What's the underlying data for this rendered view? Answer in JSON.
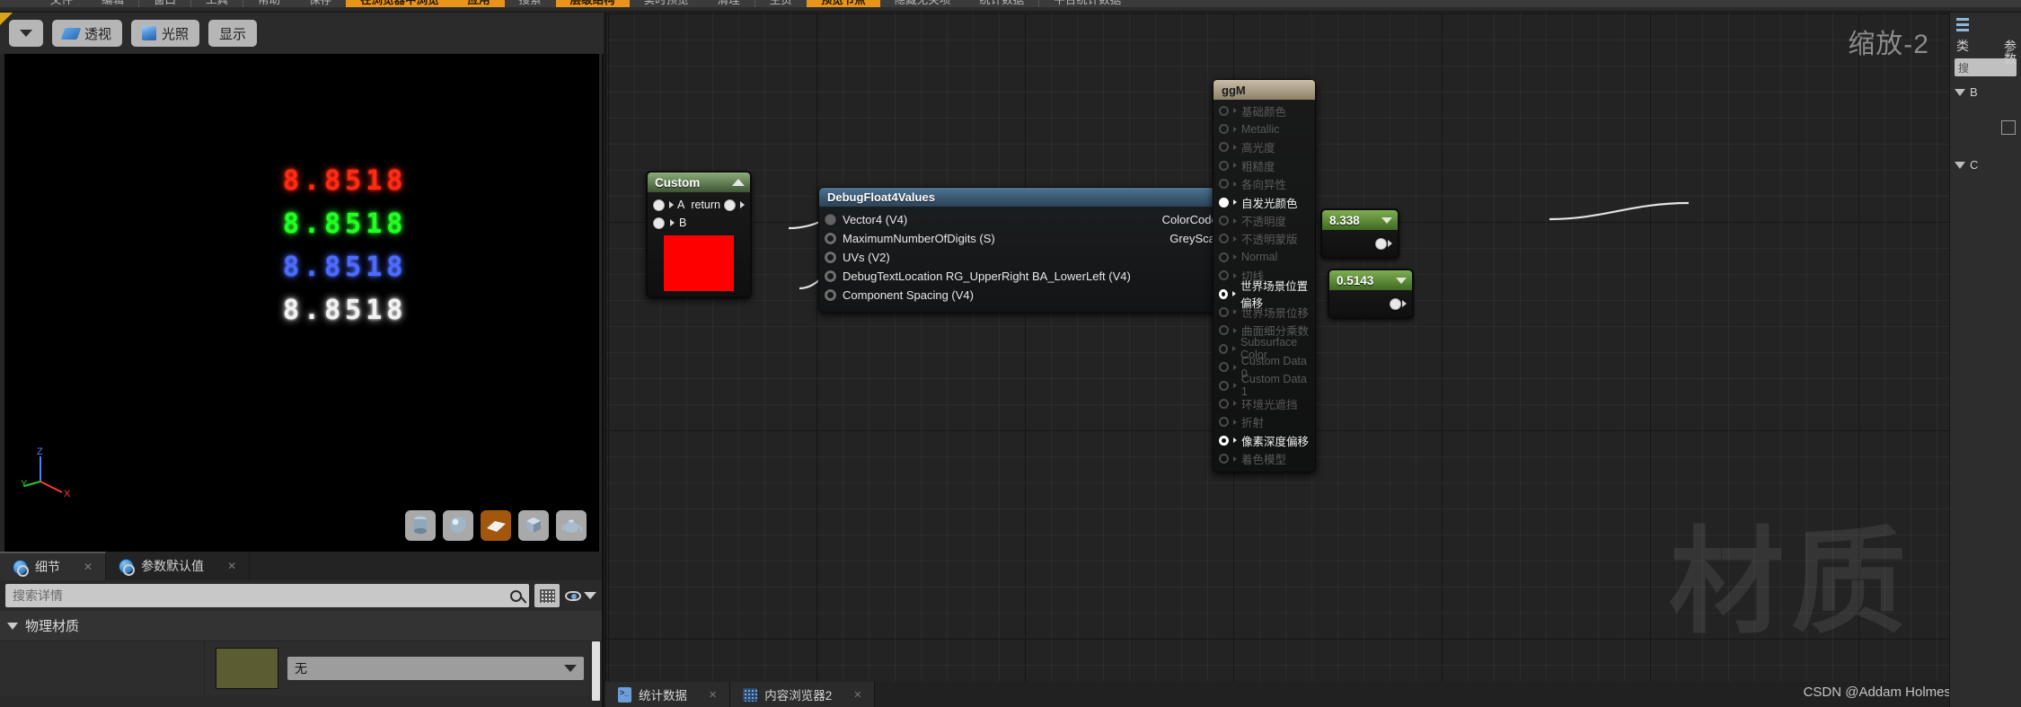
{
  "topmenu": {
    "items": [
      {
        "label": "文件",
        "style": "plain"
      },
      {
        "label": "编辑",
        "style": "plain"
      },
      {
        "label": "窗口",
        "style": "sep"
      },
      {
        "label": "工具",
        "style": "sep"
      },
      {
        "label": "帮助",
        "style": "sep"
      },
      {
        "label": "保存",
        "style": "plain"
      },
      {
        "label": "在浏览器中浏览",
        "style": "orange"
      },
      {
        "label": "应用",
        "style": "orange"
      },
      {
        "label": "搜索",
        "style": "plain"
      },
      {
        "label": "层级结构",
        "style": "orange"
      },
      {
        "label": "实时预览",
        "style": "plain"
      },
      {
        "label": "清理",
        "style": "plain"
      },
      {
        "label": "主页",
        "style": "plain"
      },
      {
        "label": "预览节点",
        "style": "orange"
      },
      {
        "label": "隐藏无关项",
        "style": "plain"
      },
      {
        "label": "统计数据",
        "style": "plain"
      },
      {
        "label": "平台统计数据",
        "style": "plain"
      }
    ]
  },
  "viewport": {
    "toolbar": {
      "dropdown_label": "",
      "perspective_label": "透视",
      "lighting_label": "光照",
      "show_label": "显示"
    },
    "debug_rows": [
      {
        "value": "8.8518",
        "color": "#ff2a12"
      },
      {
        "value": "8.8518",
        "color": "#22ff22"
      },
      {
        "value": "8.8518",
        "color": "#4d6bff"
      },
      {
        "value": "8.8518",
        "color": "#f2f2f2"
      }
    ],
    "axis": {
      "x": "X",
      "y": "Y",
      "z": "Z"
    },
    "shape_buttons": [
      {
        "name": "cylinder",
        "active": false
      },
      {
        "name": "sphere",
        "active": false
      },
      {
        "name": "plane",
        "active": true
      },
      {
        "name": "cube",
        "active": false
      },
      {
        "name": "teapot",
        "active": false
      }
    ]
  },
  "details": {
    "tabs": [
      {
        "label": "细节",
        "active": true,
        "close": "✕"
      },
      {
        "label": "参数默认值",
        "active": false,
        "close": "✕"
      }
    ],
    "search_placeholder": "搜索详情",
    "category": "物理材质",
    "property_value": "无"
  },
  "graph": {
    "zoom_label": "缩放-2",
    "watermark": "材质",
    "const_nodes": [
      {
        "value": "8.338"
      },
      {
        "value": "0.5143"
      }
    ],
    "custom_node": {
      "title": "Custom",
      "inputs": [
        "A",
        "B"
      ],
      "output": "return",
      "preview_color": "#ff0000"
    },
    "debug_node": {
      "title": "DebugFloat4Values",
      "inputs": [
        "Vector4 (V4)",
        "MaximumNumberOfDigits (S)",
        "UVs (V2)",
        "DebugTextLocation RG_UpperRight BA_LowerLeft (V4)",
        "Component Spacing (V4)"
      ],
      "outputs": [
        "ColorCodedOutput",
        "GreyScaleOutput"
      ]
    },
    "material_node": {
      "title": "ggM",
      "pins": [
        {
          "label": "基础颜色",
          "connected": false
        },
        {
          "label": "Metallic",
          "connected": false
        },
        {
          "label": "高光度",
          "connected": false
        },
        {
          "label": "粗糙度",
          "connected": false
        },
        {
          "label": "各向异性",
          "connected": false
        },
        {
          "label": "自发光颜色",
          "connected": true
        },
        {
          "label": "不透明度",
          "connected": false
        },
        {
          "label": "不透明蒙版",
          "connected": false
        },
        {
          "label": "Normal",
          "connected": false
        },
        {
          "label": "切线",
          "connected": false
        },
        {
          "label": "世界场景位置偏移",
          "connected": true
        },
        {
          "label": "世界场景位移",
          "connected": false
        },
        {
          "label": "曲面细分乘数",
          "connected": false
        },
        {
          "label": "Subsurface Color",
          "connected": false
        },
        {
          "label": "Custom Data 0",
          "connected": false
        },
        {
          "label": "Custom Data 1",
          "connected": false
        },
        {
          "label": "环境光遮挡",
          "connected": false
        },
        {
          "label": "折射",
          "connected": false
        },
        {
          "label": "像素深度偏移",
          "connected": true
        },
        {
          "label": "着色模型",
          "connected": false
        }
      ]
    }
  },
  "bottom_tabs": [
    {
      "label": "统计数据",
      "icon": "stats-icon",
      "close": "✕"
    },
    {
      "label": "内容浏览器2",
      "icon": "content-browser-icon",
      "close": "✕"
    }
  ],
  "credit": "CSDN @Addam Holmes",
  "rightbar": {
    "title": "类",
    "search_placeholder": "搜",
    "items": [
      "B",
      "C"
    ],
    "vertical_tab": "参数"
  }
}
